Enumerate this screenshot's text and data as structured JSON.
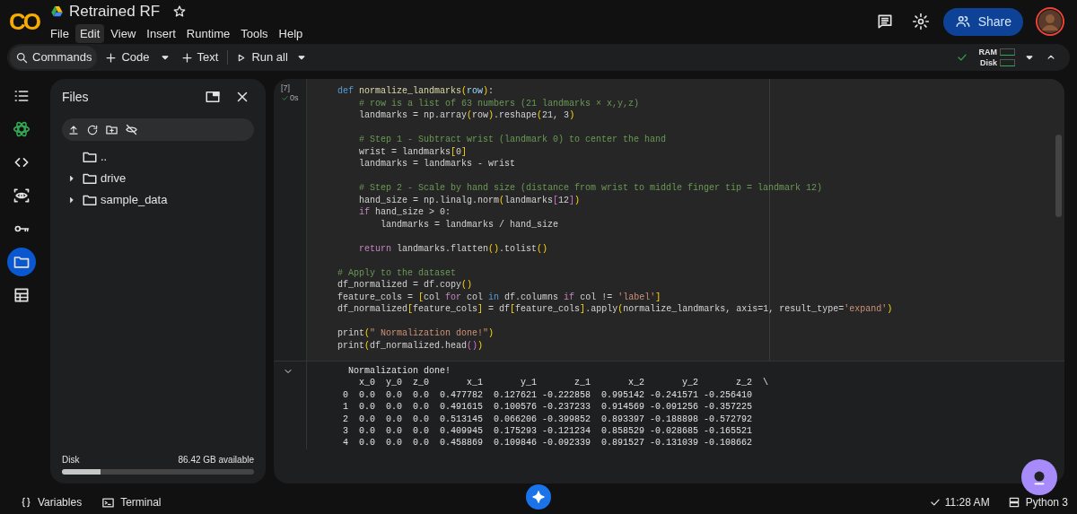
{
  "app": {
    "logo": "CO",
    "title": "Retrained RF",
    "starred": false
  },
  "menu": [
    {
      "label": "File",
      "selected": false
    },
    {
      "label": "Edit",
      "selected": true
    },
    {
      "label": "View",
      "selected": false
    },
    {
      "label": "Insert",
      "selected": false
    },
    {
      "label": "Runtime",
      "selected": false
    },
    {
      "label": "Tools",
      "selected": false
    },
    {
      "label": "Help",
      "selected": false
    }
  ],
  "share_button": "Share",
  "toolbar": {
    "commands": "Commands",
    "code": "Code",
    "text": "Text",
    "run_all": "Run all",
    "ram_label": "RAM",
    "disk_label": "Disk",
    "connected": true
  },
  "rail": [
    {
      "kind": "toc",
      "selected": false
    },
    {
      "kind": "gemini",
      "selected": false
    },
    {
      "kind": "code",
      "selected": false
    },
    {
      "kind": "variables",
      "selected": false
    },
    {
      "kind": "secrets",
      "selected": false
    },
    {
      "kind": "files",
      "selected": true
    },
    {
      "kind": "table",
      "selected": false
    }
  ],
  "files_panel": {
    "title": "Files",
    "tree": [
      {
        "name": "..",
        "expandable": false,
        "expanded": false
      },
      {
        "name": "drive",
        "expandable": true,
        "expanded": false
      },
      {
        "name": "sample_data",
        "expandable": true,
        "expanded": false
      }
    ],
    "disk_label": "Disk",
    "disk_available": "86.42 GB available",
    "disk_usage": {
      "level": 0.2
    }
  },
  "cell": {
    "exec_count": "[7]",
    "duration": "0s",
    "succeeded": true,
    "code_blocks": [
      [
        [
          {
            "kind": "kw",
            "text": "def "
          },
          {
            "kind": "fn",
            "text": "normalize_landmarks"
          },
          {
            "kind": "p",
            "text": "("
          },
          {
            "kind": "var",
            "text": "row"
          },
          {
            "kind": "p",
            "text": ")"
          },
          {
            "kind": "t",
            "text": ":"
          }
        ],
        [
          {
            "kind": "c",
            "text": "    # row is a list of 63 numbers (21 landmarks × x,y,z)"
          }
        ],
        [
          {
            "kind": "t",
            "text": "    landmarks = np.array"
          },
          {
            "kind": "p",
            "text": "("
          },
          {
            "kind": "t",
            "text": "row"
          },
          {
            "kind": "p",
            "text": ")"
          },
          {
            "kind": "t",
            "text": ".reshape"
          },
          {
            "kind": "p",
            "text": "("
          },
          {
            "kind": "t",
            "text": "21, 3"
          },
          {
            "kind": "p",
            "text": ")"
          }
        ]
      ],
      [
        [
          {
            "kind": "c",
            "text": "    # Step 1 - Subtract wrist (landmark 0) to center the hand"
          }
        ],
        [
          {
            "kind": "t",
            "text": "    wrist = landmarks"
          },
          {
            "kind": "p",
            "text": "["
          },
          {
            "kind": "t",
            "text": "0"
          },
          {
            "kind": "p",
            "text": "]"
          }
        ],
        [
          {
            "kind": "t",
            "text": "    landmarks = landmarks - wrist"
          }
        ]
      ],
      [
        [
          {
            "kind": "c",
            "text": "    # Step 2 - Scale by hand size (distance from wrist to middle finger tip = landmark 12)"
          }
        ],
        [
          {
            "kind": "t",
            "text": "    hand_size = np.linalg.norm"
          },
          {
            "kind": "p",
            "text": "("
          },
          {
            "kind": "t",
            "text": "landmarks"
          },
          {
            "kind": "b",
            "text": "["
          },
          {
            "kind": "t",
            "text": "12"
          },
          {
            "kind": "b",
            "text": "]"
          },
          {
            "kind": "p",
            "text": ")"
          }
        ],
        [
          {
            "kind": "kw2",
            "text": "    if"
          },
          {
            "kind": "t",
            "text": " hand_size > 0:"
          }
        ],
        [
          {
            "kind": "t",
            "text": "        landmarks = landmarks / hand_size"
          }
        ]
      ],
      [
        [
          {
            "kind": "kw2",
            "text": "    return"
          },
          {
            "kind": "t",
            "text": " landmarks.flatten"
          },
          {
            "kind": "p",
            "text": "()"
          },
          {
            "kind": "t",
            "text": ".tolist"
          },
          {
            "kind": "p",
            "text": "()"
          }
        ]
      ],
      [
        [
          {
            "kind": "c",
            "text": "# Apply to the dataset"
          }
        ],
        [
          {
            "kind": "t",
            "text": "df_normalized = df.copy"
          },
          {
            "kind": "p",
            "text": "()"
          }
        ],
        [
          {
            "kind": "t",
            "text": "feature_cols = "
          },
          {
            "kind": "p",
            "text": "["
          },
          {
            "kind": "t",
            "text": "col "
          },
          {
            "kind": "kw2",
            "text": "for"
          },
          {
            "kind": "t",
            "text": " col "
          },
          {
            "kind": "kw",
            "text": "in"
          },
          {
            "kind": "t",
            "text": " df.columns "
          },
          {
            "kind": "kw2",
            "text": "if"
          },
          {
            "kind": "t",
            "text": " col != "
          },
          {
            "kind": "s",
            "text": "'label'"
          },
          {
            "kind": "p",
            "text": "]"
          }
        ],
        [
          {
            "kind": "t",
            "text": "df_normalized"
          },
          {
            "kind": "p",
            "text": "["
          },
          {
            "kind": "t",
            "text": "feature_cols"
          },
          {
            "kind": "p",
            "text": "]"
          },
          {
            "kind": "t",
            "text": " = df"
          },
          {
            "kind": "p",
            "text": "["
          },
          {
            "kind": "t",
            "text": "feature_cols"
          },
          {
            "kind": "p",
            "text": "]"
          },
          {
            "kind": "t",
            "text": ".apply"
          },
          {
            "kind": "p",
            "text": "("
          },
          {
            "kind": "t",
            "text": "normalize_landmarks, axis=1, result_type="
          },
          {
            "kind": "s",
            "text": "'expand'"
          },
          {
            "kind": "p",
            "text": ")"
          }
        ]
      ],
      [
        [
          {
            "kind": "t",
            "text": "print"
          },
          {
            "kind": "p",
            "text": "("
          },
          {
            "kind": "s",
            "text": "\" Normalization done!\""
          },
          {
            "kind": "p",
            "text": ")"
          }
        ],
        [
          {
            "kind": "t",
            "text": "print"
          },
          {
            "kind": "p",
            "text": "("
          },
          {
            "kind": "t",
            "text": "df_normalized.head"
          },
          {
            "kind": "b",
            "text": "()"
          },
          {
            "kind": "p",
            "text": ")"
          }
        ]
      ]
    ],
    "output": [
      " Normalization done!",
      "   x_0  y_0  z_0       x_1       y_1       z_1       x_2       y_2       z_2  \\",
      "0  0.0  0.0  0.0  0.477782  0.127621 -0.222858  0.995142 -0.241571 -0.256410",
      "1  0.0  0.0  0.0  0.491615  0.100576 -0.237233  0.914569 -0.091256 -0.357225",
      "2  0.0  0.0  0.0  0.513145  0.066206 -0.399852  0.893397 -0.188898 -0.572792",
      "3  0.0  0.0  0.0  0.409945  0.175293 -0.121234  0.858529 -0.028685 -0.165521",
      "4  0.0  0.0  0.0  0.458869  0.109846 -0.092339  0.891527 -0.131039 -0.108662"
    ]
  },
  "status_bar": {
    "variables": "Variables",
    "terminal": "Terminal",
    "time": "11:28 AM",
    "runtime": "Python 3"
  }
}
